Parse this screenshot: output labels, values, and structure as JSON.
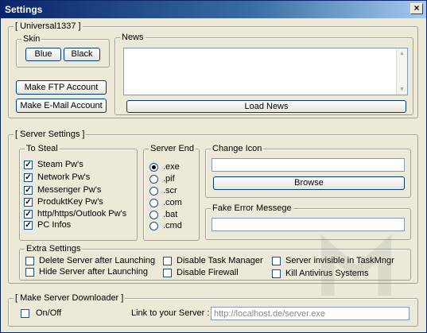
{
  "window": {
    "title": "Settings",
    "close_glyph": "×"
  },
  "account": {
    "legend": "[ Universal1337 ]",
    "skin": {
      "legend": "Skin",
      "blue": "Blue",
      "black": "Black"
    },
    "ftp_button": "Make FTP Account",
    "email_button": "Make E-Mail Account",
    "news": {
      "legend": "News",
      "content": "",
      "load_button": "Load News"
    }
  },
  "server": {
    "legend": "[ Server Settings ]",
    "to_steal": {
      "legend": "To Steal",
      "items": [
        {
          "label": "Steam Pw's",
          "checked": true
        },
        {
          "label": "Network Pw's",
          "checked": true
        },
        {
          "label": "Messenger Pw's",
          "checked": true
        },
        {
          "label": "ProduktKey Pw's",
          "checked": true
        },
        {
          "label": "http/https/Outlook Pw's",
          "checked": true
        },
        {
          "label": "PC Infos",
          "checked": true
        }
      ]
    },
    "server_end": {
      "legend": "Server End",
      "options": [
        ".exe",
        ".pif",
        ".scr",
        ".com",
        ".bat",
        ".cmd"
      ],
      "selected": ".exe"
    },
    "change_icon": {
      "legend": "Change Icon",
      "path_value": "",
      "browse_button": "Browse"
    },
    "fake_error": {
      "legend": "Fake Error Messege",
      "value": ""
    },
    "extra": {
      "legend": "Extra Settings",
      "items": [
        {
          "label": "Delete Server after Launching",
          "checked": false
        },
        {
          "label": "Hide Server after Launching",
          "checked": false
        },
        {
          "label": "Disable Task Manager",
          "checked": false
        },
        {
          "label": "Disable Firewall",
          "checked": false
        },
        {
          "label": "Server invisible in TaskMngr",
          "checked": false
        },
        {
          "label": "Kill Antivirus Systems",
          "checked": false
        }
      ]
    }
  },
  "downloader": {
    "legend": "[ Make Server Downloader ]",
    "onoff_label": "On/Off",
    "onoff_checked": false,
    "link_label": "Link to your Server :",
    "link_value": "http://localhost.de/server.exe"
  },
  "colors": {
    "face": "#ece9d8",
    "title_start": "#0a246a",
    "title_end": "#a6caf0",
    "button_border": "#003c74"
  }
}
